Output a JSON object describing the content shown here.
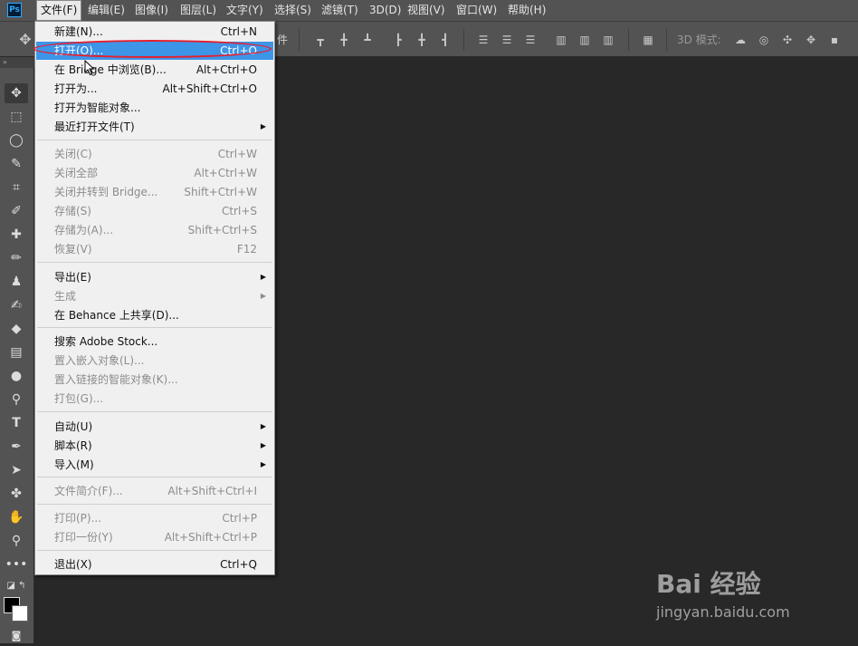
{
  "app": {
    "logo_text": "Ps"
  },
  "menubar": [
    {
      "label": "文件(F)",
      "active": true
    },
    {
      "label": "编辑(E)"
    },
    {
      "label": "图像(I)"
    },
    {
      "label": "图层(L)"
    },
    {
      "label": "文字(Y)"
    },
    {
      "label": "选择(S)"
    },
    {
      "label": "滤镜(T)"
    },
    {
      "label": "3D(D)"
    },
    {
      "label": "视图(V)"
    },
    {
      "label": "窗口(W)"
    },
    {
      "label": "帮助(H)"
    }
  ],
  "optionsbar": {
    "mode_label": "3D 模式:",
    "truncated_text": "件"
  },
  "file_menu": {
    "items": [
      {
        "label": "新建(N)...",
        "shortcut": "Ctrl+N"
      },
      {
        "label": "打开(O)...",
        "shortcut": "Ctrl+O",
        "highlighted": true
      },
      {
        "label": "在 Bridge 中浏览(B)...",
        "shortcut": "Alt+Ctrl+O"
      },
      {
        "label": "打开为...",
        "shortcut": "Alt+Shift+Ctrl+O"
      },
      {
        "label": "打开为智能对象..."
      },
      {
        "label": "最近打开文件(T)",
        "submenu": true
      },
      {
        "label": "关闭(C)",
        "shortcut": "Ctrl+W",
        "disabled": true
      },
      {
        "label": "关闭全部",
        "shortcut": "Alt+Ctrl+W",
        "disabled": true
      },
      {
        "label": "关闭并转到 Bridge...",
        "shortcut": "Shift+Ctrl+W",
        "disabled": true
      },
      {
        "label": "存储(S)",
        "shortcut": "Ctrl+S",
        "disabled": true
      },
      {
        "label": "存储为(A)...",
        "shortcut": "Shift+Ctrl+S",
        "disabled": true
      },
      {
        "label": "恢复(V)",
        "shortcut": "F12",
        "disabled": true
      },
      {
        "label": "导出(E)",
        "submenu": true
      },
      {
        "label": "生成",
        "submenu": true,
        "disabled": true
      },
      {
        "label": "在 Behance 上共享(D)..."
      },
      {
        "label": "搜索 Adobe Stock..."
      },
      {
        "label": "置入嵌入对象(L)...",
        "disabled": true
      },
      {
        "label": "置入链接的智能对象(K)...",
        "disabled": true
      },
      {
        "label": "打包(G)...",
        "disabled": true
      },
      {
        "label": "自动(U)",
        "submenu": true
      },
      {
        "label": "脚本(R)",
        "submenu": true
      },
      {
        "label": "导入(M)",
        "submenu": true
      },
      {
        "label": "文件简介(F)...",
        "shortcut": "Alt+Shift+Ctrl+I",
        "disabled": true
      },
      {
        "label": "打印(P)...",
        "shortcut": "Ctrl+P",
        "disabled": true
      },
      {
        "label": "打印一份(Y)",
        "shortcut": "Alt+Shift+Ctrl+P",
        "disabled": true
      },
      {
        "label": "退出(X)",
        "shortcut": "Ctrl+Q"
      }
    ]
  },
  "watermark": {
    "main": "Bai 经验",
    "sub": "jingyan.baidu.com"
  },
  "colors": {
    "highlight": "#3d95e8",
    "annotation_ring": "#e5202e",
    "menubar": "#535353",
    "canvas": "#282828"
  }
}
